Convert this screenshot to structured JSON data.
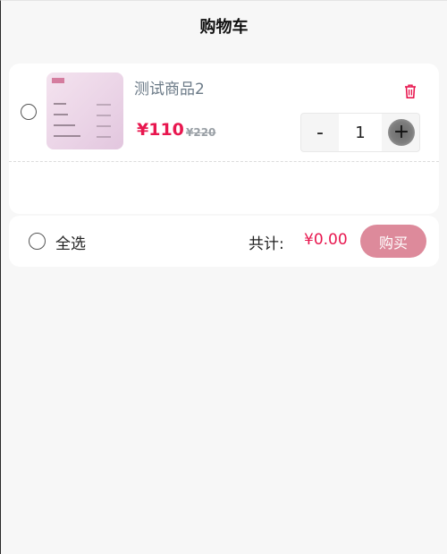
{
  "header": {
    "title": "购物车"
  },
  "cart": {
    "items": [
      {
        "name": "测试商品2",
        "price": "¥110",
        "original_price": "¥220",
        "quantity": "1",
        "minus_label": "-",
        "plus_label": "+",
        "selected": false,
        "icons": {
          "delete": "trash-icon",
          "thumbnail": "product-thumbnail"
        }
      }
    ]
  },
  "footer": {
    "select_all_label": "全选",
    "total_label": "共计:",
    "total_value": "¥0.00",
    "buy_label": "购买"
  },
  "colors": {
    "accent": "#e8174f",
    "buy_button": "#dd8a9b",
    "background": "#f7f7f7",
    "card": "#ffffff",
    "product_name": "#6b7a87"
  }
}
